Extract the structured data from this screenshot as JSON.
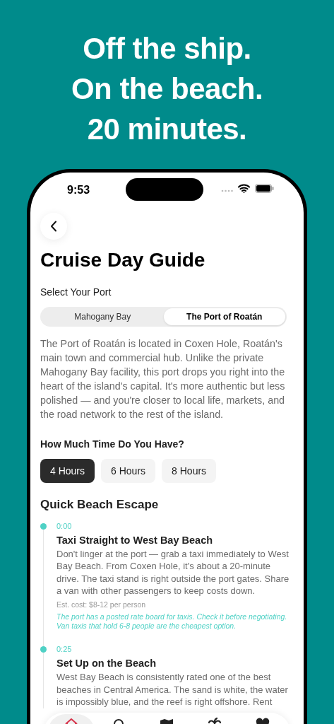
{
  "headline": [
    "Off the ship.",
    "On the beach.",
    "20 minutes."
  ],
  "status_bar": {
    "time": "9:53"
  },
  "title": "Cruise Day Guide",
  "port_label": "Select Your Port",
  "ports": [
    {
      "label": "Mahogany Bay",
      "selected": false
    },
    {
      "label": "The Port of Roatán",
      "selected": true
    }
  ],
  "description": "The Port of Roatán is located in Coxen Hole, Roatán's main town and commercial hub. Unlike the private Mahogany Bay facility, this port drops you right into the heart of the island's capital. It's more authentic but less polished — and you're closer to local life, markets, and the road network to the rest of the island.",
  "time_label": "How Much Time Do You Have?",
  "durations": [
    {
      "label": "4 Hours",
      "selected": true
    },
    {
      "label": "6 Hours",
      "selected": false
    },
    {
      "label": "8 Hours",
      "selected": false
    }
  ],
  "section_title": "Quick Beach Escape",
  "timeline": [
    {
      "time": "0:00",
      "title": "Taxi Straight to West Bay Beach",
      "body": "Don't linger at the port — grab a taxi immediately to West Bay Beach. From Coxen Hole, it's about a 20-minute drive. The taxi stand is right outside the port gates. Share a van with other passengers to keep costs down.",
      "cost": "Est. cost: $8-12 per person",
      "tip": "The port has a posted rate board for taxis. Check it before negotiating. Van taxis that hold 6-8 people are the cheapest option."
    },
    {
      "time": "0:25",
      "title": "Set Up on the Beach",
      "body": "West Bay Beach is consistently rated one of the best beaches in Central America. The sand is white, the water is impossibly blue, and the reef is right offshore. Rent"
    }
  ],
  "tab_bar": [
    {
      "kind": "home",
      "selected": true
    },
    {
      "kind": "search",
      "selected": false
    },
    {
      "kind": "map",
      "selected": false
    },
    {
      "kind": "palm",
      "selected": false
    },
    {
      "kind": "heart",
      "selected": false
    }
  ]
}
